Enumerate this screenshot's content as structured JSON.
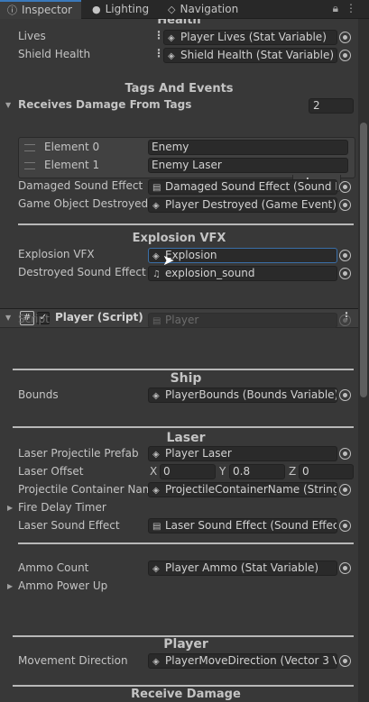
{
  "tabs": [
    {
      "label": "Inspector",
      "icon": "info-icon"
    },
    {
      "label": "Lighting",
      "icon": "lightbulb-icon"
    },
    {
      "label": "Navigation",
      "icon": "navigation-icon"
    }
  ],
  "colors": {
    "accent": "#3a79bb",
    "background": "#383838",
    "field": "#2a2a2a"
  },
  "sections": {
    "health": "Health",
    "tags_events": "Tags And Events",
    "explosion_vfx": "Explosion VFX",
    "ship": "Ship",
    "laser": "Laser",
    "player": "Player",
    "receive_damage": "Receive Damage"
  },
  "fields": {
    "lives": {
      "label": "Lives",
      "value": "Player Lives (Stat Variable)"
    },
    "shield_health": {
      "label": "Shield Health",
      "value": "Shield Health (Stat Variable)"
    },
    "damaged_sound": {
      "label": "Damaged Sound Effect",
      "value": "Damaged Sound Effect (Sound Effe"
    },
    "game_object_destroyed": {
      "label": "Game Object Destroyed",
      "value": "Player Destroyed (Game Event)"
    },
    "explosion_vfx": {
      "label": "Explosion VFX",
      "value": "Explosion"
    },
    "destroyed_sound": {
      "label": "Destroyed Sound Effect",
      "value": "explosion_sound"
    },
    "script": {
      "label": "Script",
      "value": "Player"
    },
    "bounds": {
      "label": "Bounds",
      "value": "PlayerBounds (Bounds Variable)"
    },
    "laser_prefab": {
      "label": "Laser Projectile Prefab",
      "value": "Player Laser"
    },
    "laser_offset": {
      "label": "Laser Offset",
      "x_label": "X",
      "x": "0",
      "y_label": "Y",
      "y": "0.8",
      "z_label": "Z",
      "z": "0"
    },
    "projectile_container": {
      "label": "Projectile Container Name",
      "value": "ProjectileContainerName (String V"
    },
    "fire_delay_timer": {
      "label": "Fire Delay Timer"
    },
    "laser_sound": {
      "label": "Laser Sound Effect",
      "value": "Laser Sound Effect (Sound Effect)"
    },
    "ammo_count": {
      "label": "Ammo Count",
      "value": "Player Ammo (Stat Variable)"
    },
    "ammo_power_up": {
      "label": "Ammo Power Up"
    },
    "movement_direction": {
      "label": "Movement Direction",
      "value": "PlayerMoveDirection (Vector 3 Va"
    }
  },
  "receives_damage": {
    "label": "Receives Damage From Tags",
    "count": "2",
    "elements": [
      {
        "label": "Element 0",
        "value": "Enemy"
      },
      {
        "label": "Element 1",
        "value": "Enemy Laser"
      }
    ],
    "add": "+",
    "remove": "−"
  },
  "component": {
    "title": "Player (Script)",
    "enabled": true
  }
}
